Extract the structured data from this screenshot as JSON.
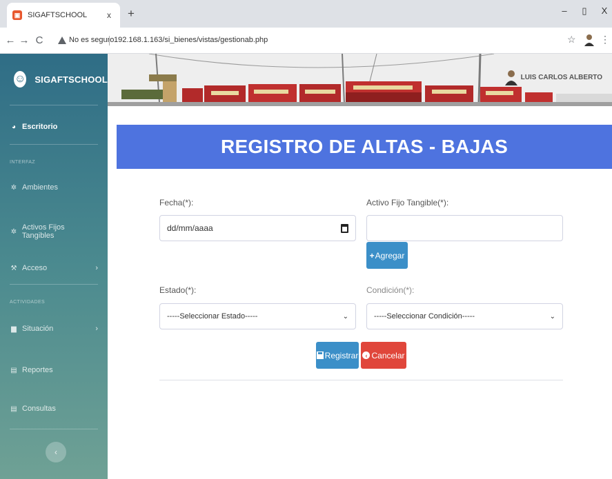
{
  "browser": {
    "tab_title": "SIGAFTSCHOOL",
    "tab_close": "x",
    "new_tab": "+",
    "security_label": "No es seguro",
    "url": "192.168.1.163/si_bienes/vistas/gestionab.php",
    "window_controls": {
      "minimize": "–",
      "restore": "▯",
      "close": "X"
    }
  },
  "sidebar": {
    "brand": "SIGAFTSCHOOL",
    "items": [
      {
        "label": "Escritorio",
        "icon": "dashboard-icon"
      },
      {
        "label": "Ambientes",
        "icon": "gear-icon"
      },
      {
        "label": "Activos Fijos Tangibles",
        "icon": "gear-icon"
      },
      {
        "label": "Acceso",
        "icon": "wrench-icon"
      },
      {
        "label": "Situación",
        "icon": "folder-icon"
      },
      {
        "label": "Reportes",
        "icon": "table-icon"
      },
      {
        "label": "Consultas",
        "icon": "table-icon"
      }
    ],
    "headings": {
      "interfaz": "INTERFAZ",
      "actividades": "ACTIVIDADES"
    }
  },
  "header": {
    "user_name": "LUIS CARLOS ALBERTO"
  },
  "main": {
    "title": "REGISTRO DE ALTAS - BAJAS",
    "fecha_label": "Fecha(*):",
    "fecha_placeholder": "dd/mm/aaaa",
    "activo_label": "Activo Fijo Tangible(*):",
    "activo_value": "",
    "agregar_label": "Agregar",
    "estado_label": "Estado(*):",
    "estado_selected": "-----Seleccionar Estado-----",
    "condicion_label": "Condición(*):",
    "condicion_selected": "-----Seleccionar Condición-----",
    "registrar_label": "Registrar",
    "cancelar_label": "Cancelar"
  },
  "colors": {
    "title_bar": "#4e73df",
    "primary_button": "#3b8fc8",
    "danger_button": "#e0463b",
    "sidebar_top": "#2f6d86",
    "sidebar_bottom": "#6fa195"
  }
}
